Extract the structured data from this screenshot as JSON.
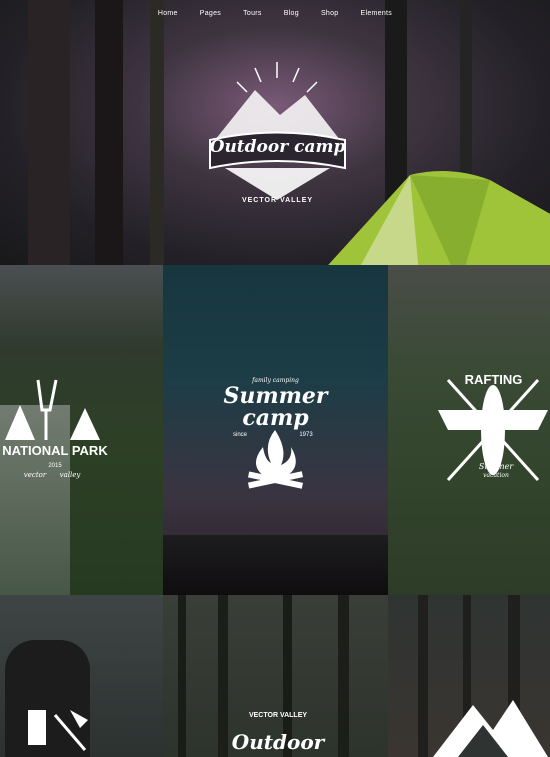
{
  "nav": {
    "items": [
      "Home",
      "Pages",
      "Tours",
      "Blog",
      "Shop",
      "Elements"
    ]
  },
  "hero": {
    "badge_title": "Outdoor camp",
    "badge_sub": "VECTOR VALLEY"
  },
  "tiles": {
    "national_park": {
      "title": "NATIONAL PARK",
      "since": "2015",
      "sub_left": "vector",
      "sub_right": "valley"
    },
    "summer_camp": {
      "top": "family camping",
      "line1": "Summer",
      "line2": "camp",
      "since": "since",
      "year": "1973"
    },
    "rafting": {
      "title": "RAFTING",
      "line1": "Summer",
      "line2": "vacation"
    },
    "outdoor_camp": {
      "sub": "VECTOR VALLEY",
      "title": "Outdoor camp"
    }
  },
  "colors": {
    "white": "#ffffff",
    "tent_green": "#9fc43a"
  }
}
